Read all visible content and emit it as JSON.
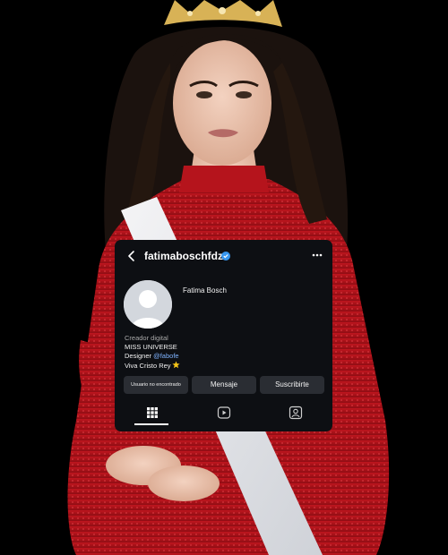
{
  "profile": {
    "username": "fatimaboschfdz",
    "full_name": "Fatima Bosch",
    "verified": true,
    "bio": {
      "category": "Creador digital",
      "line1": "MISS UNIVERSE",
      "line2_prefix": "Designer ",
      "line2_mention": "@fabofe",
      "line3": "Viva Cristo Rey"
    }
  },
  "buttons": {
    "not_found": "Usuario no encontrado",
    "message": "Mensaje",
    "subscribe": "Suscribirte"
  },
  "tabs": [
    "grid-icon",
    "reels-icon",
    "tagged-icon"
  ],
  "colors": {
    "card_bg": "#0d0f13",
    "button_bg": "#2a2d33",
    "verified_blue": "#3897f0",
    "mention_blue": "#7fb3ff",
    "dress_red": "#b3141c"
  }
}
